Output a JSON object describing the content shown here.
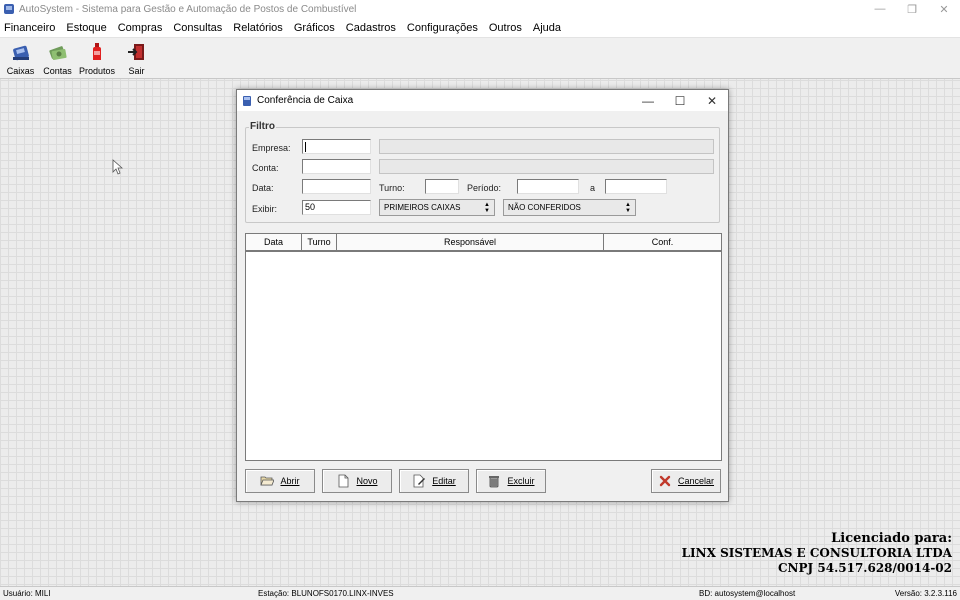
{
  "window": {
    "title": "AutoSystem - Sistema para Gestão e Automação de Postos de Combustível",
    "controls": {
      "minimize": "—",
      "restore": "❐",
      "close": "✕"
    }
  },
  "menu": [
    {
      "label": "Financeiro"
    },
    {
      "label": "Estoque"
    },
    {
      "label": "Compras"
    },
    {
      "label": "Consultas"
    },
    {
      "label": "Relatórios"
    },
    {
      "label": "Gráficos"
    },
    {
      "label": "Cadastros"
    },
    {
      "label": "Configurações"
    },
    {
      "label": "Outros"
    },
    {
      "label": "Ajuda"
    }
  ],
  "toolbar": [
    {
      "label": "Caixas",
      "icon": "cash-register-icon"
    },
    {
      "label": "Contas",
      "icon": "money-icon"
    },
    {
      "label": "Produtos",
      "icon": "product-bottle-icon"
    },
    {
      "label": "Sair",
      "icon": "exit-door-icon"
    }
  ],
  "dialog": {
    "title": "Conferência de Caixa",
    "controls": {
      "minimize": "—",
      "maximize": "☐",
      "close": "✕"
    },
    "filter": {
      "legend": "Filtro",
      "empresa_label": "Empresa:",
      "empresa_value": "",
      "conta_label": "Conta:",
      "conta_value": "",
      "data_label": "Data:",
      "data_value": "",
      "turno_label": "Turno:",
      "turno_value": "",
      "periodo_label": "Período:",
      "periodo_from": "",
      "periodo_sep": "a",
      "periodo_to": "",
      "exibir_label": "Exibir:",
      "exibir_value": "50",
      "order_select": "PRIMEIROS CAIXAS",
      "status_select": "NÃO CONFERIDOS"
    },
    "table": {
      "columns": [
        "Data",
        "Turno",
        "Responsável",
        "Conf."
      ],
      "rows": []
    },
    "buttons": {
      "abrir": "Abrir",
      "novo": "Novo",
      "editar": "Editar",
      "excluir": "Excluir",
      "cancelar": "Cancelar"
    }
  },
  "license": {
    "line1": "Licenciado para:",
    "line2": "LINX SISTEMAS E CONSULTORIA LTDA",
    "line3": "CNPJ 54.517.628/0014-02"
  },
  "status": {
    "usuario": "Usuário: MILI",
    "estacao": "Estação: BLUNOFS0170.LINX-INVES",
    "bd": "BD: autosystem@localhost",
    "versao": "Versão: 3.2.3.116"
  },
  "colors": {
    "accent": "#3a5fb0",
    "cancel_icon": "#c0392b"
  }
}
